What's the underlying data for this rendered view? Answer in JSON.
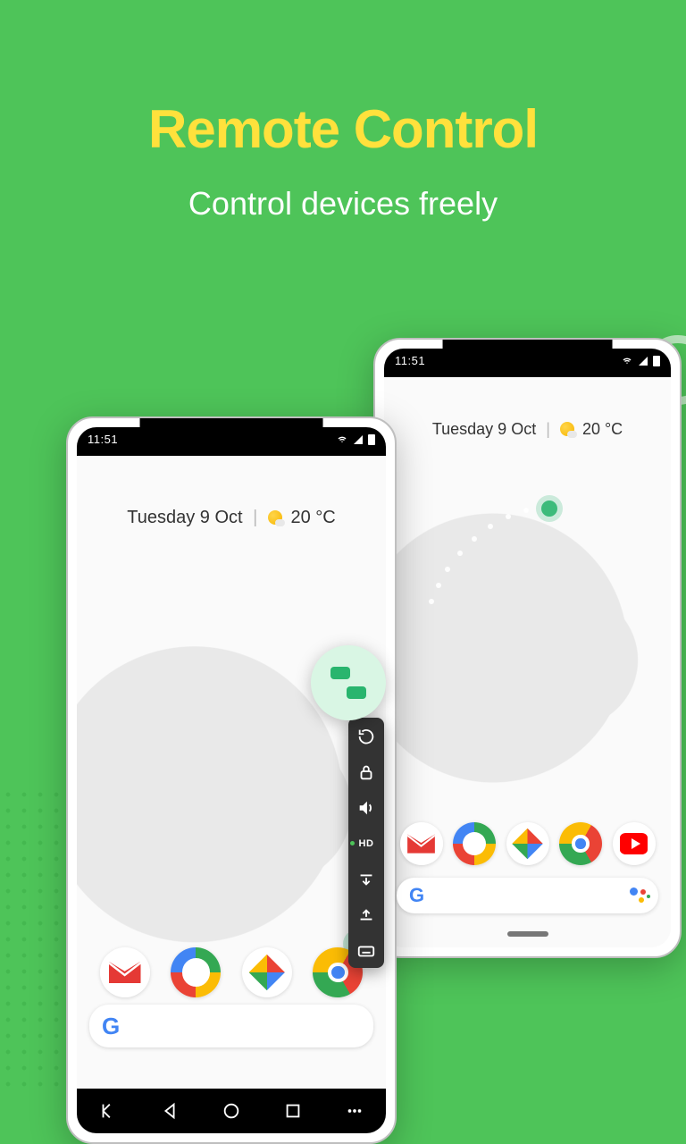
{
  "hero": {
    "title": "Remote Control",
    "subtitle": "Control devices freely"
  },
  "phone": {
    "status_time": "11:51",
    "date": "Tuesday 9 Oct",
    "temp": "20 °C"
  },
  "dock_back": [
    "gmail",
    "maps",
    "photos",
    "chrome",
    "youtube"
  ],
  "dock_front": [
    "gmail",
    "maps",
    "photos",
    "chrome"
  ],
  "search": {
    "logo": "G"
  },
  "toolbar": {
    "items": [
      "rotate",
      "lock",
      "volume",
      "hd",
      "swipe-down",
      "swipe-up",
      "keyboard"
    ],
    "hd_label": "HD"
  },
  "softnav": [
    "hide",
    "back",
    "home",
    "recent",
    "more"
  ]
}
